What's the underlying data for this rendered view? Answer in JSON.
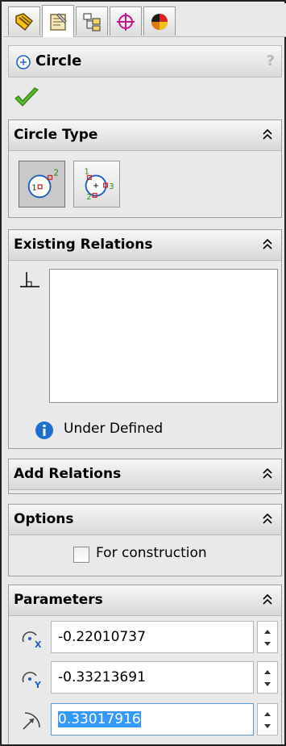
{
  "tabs": [
    {
      "icon": "feature-manager-icon",
      "active": false
    },
    {
      "icon": "property-manager-icon",
      "active": true
    },
    {
      "icon": "configuration-manager-icon",
      "active": false
    },
    {
      "icon": "dimxpert-manager-icon",
      "active": false
    },
    {
      "icon": "display-manager-icon",
      "active": false
    }
  ],
  "title": {
    "label": "Circle",
    "help": "?"
  },
  "circle_type": {
    "header": "Circle Type",
    "options": [
      {
        "name": "center-circle",
        "selected": true,
        "labels": [
          "1",
          "2"
        ]
      },
      {
        "name": "perimeter-circle",
        "selected": false,
        "labels": [
          "1",
          "2",
          "3"
        ]
      }
    ]
  },
  "existing_relations": {
    "header": "Existing Relations",
    "status": "Under Defined"
  },
  "add_relations": {
    "header": "Add Relations"
  },
  "options": {
    "header": "Options",
    "for_construction_label": "For construction",
    "for_construction_checked": false
  },
  "parameters": {
    "header": "Parameters",
    "center_x": "-0.22010737",
    "center_y": "-0.33213691",
    "radius": "0.33017916"
  },
  "colors": {
    "panel_bg": "#e9e9e9",
    "accent_blue": "#1f5fbf",
    "ok_green": "#3a9a1a",
    "selection_blue": "#3399ff"
  }
}
